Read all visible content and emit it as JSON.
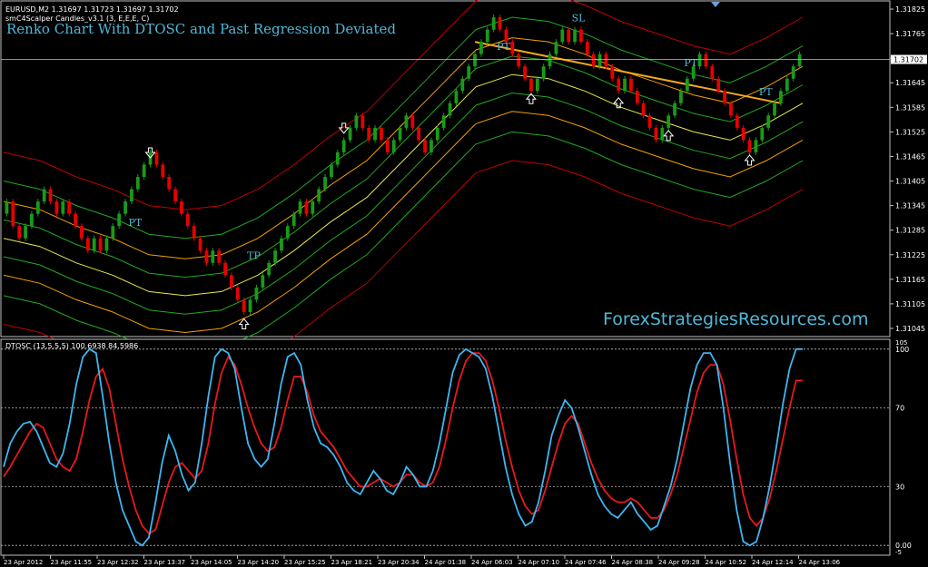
{
  "main_panel": {
    "symbol_header": "EURUSD,M2  1.31697 1.31723 1.31697 1.31702",
    "indicator_header": "smC4Scalper Candles_v3.1 (3, E,E,E, C)",
    "title": "Renko Chart With DTOSC and Past Regression Deviated",
    "watermark": "ForexStrategiesResources.com",
    "price_ticks": [
      "1.31765",
      "1.31705",
      "1.31645",
      "1.31585",
      "1.31525",
      "1.31465",
      "1.31405",
      "1.31345",
      "1.31285",
      "1.31225",
      "1.31165",
      "1.31105",
      "1.31045"
    ],
    "price_tick_values": [
      1.31765,
      1.31705,
      1.31645,
      1.31585,
      1.31525,
      1.31465,
      1.31405,
      1.31345,
      1.31285,
      1.31225,
      1.31165,
      1.31105,
      1.31045
    ],
    "current_price": "1.31702",
    "current_price_value": 1.31702,
    "top_tick": "1.31825",
    "top_tick_value": 1.31825,
    "annotations": [
      {
        "text": "PT",
        "pos": 20,
        "price": 1.31295
      },
      {
        "text": "TP",
        "pos": 39,
        "price": 1.31215
      },
      {
        "text": "PT",
        "pos": 79,
        "price": 1.31725
      },
      {
        "text": "SL",
        "pos": 91,
        "price": 1.31795
      },
      {
        "text": "PT",
        "pos": 109,
        "price": 1.31685
      },
      {
        "text": "PT",
        "pos": 121,
        "price": 1.31615
      }
    ],
    "arrows": [
      {
        "dir": "down",
        "pos": 23,
        "price": 1.31475
      },
      {
        "dir": "up",
        "pos": 38,
        "price": 1.31055
      },
      {
        "dir": "down",
        "pos": 54,
        "price": 1.31535
      },
      {
        "dir": "up",
        "pos": 84,
        "price": 1.31605
      },
      {
        "dir": "up",
        "pos": 98,
        "price": 1.31595
      },
      {
        "dir": "up",
        "pos": 106,
        "price": 1.31515
      },
      {
        "dir": "up",
        "pos": 119,
        "price": 1.31455
      }
    ],
    "top_marker_color": "#6ea0d8"
  },
  "sub_panel": {
    "header": "DTOSC (13,5,5,5) 100.6938 84.5986",
    "levels": [
      "100",
      "70",
      "30",
      "0.00"
    ],
    "level_values": [
      100,
      70,
      30,
      0
    ],
    "top_label": "105",
    "bottom_label": "-5",
    "fast_line_color": "#3fb6f0",
    "slow_line_color": "#e8191c"
  },
  "time_axis": {
    "labels": [
      "23 Apr 2012",
      "23 Apr 11:55",
      "23 Apr 12:32",
      "23 Apr 13:37",
      "23 Apr 14:05",
      "23 Apr 14:20",
      "23 Apr 15:25",
      "23 Apr 18:21",
      "23 Apr 20:34",
      "24 Apr 01:38",
      "24 Apr 06:03",
      "24 Apr 07:10",
      "24 Apr 07:46",
      "24 Apr 08:38",
      "24 Apr 09:28",
      "24 Apr 10:52",
      "24 Apr 12:14",
      "24 Apr 13:06"
    ]
  },
  "colors": {
    "bull_brick": "#1a9a1a",
    "bear_brick": "#e80000",
    "regression_line": "#f2a81d",
    "outer_band": "#c00000",
    "middle_band": "#f0a000",
    "inner_band": "#22a822",
    "center_band": "#e8e84a",
    "frame": "#c0c0c0",
    "title_text": "#4fb8d8",
    "text": "#ffffff"
  },
  "chart_data": [
    {
      "type": "renko",
      "title": "Renko Chart With DTOSC and Past Regression Deviated",
      "brick_size": 0.0003,
      "bricks_close": [
        1.31355,
        1.31295,
        1.31265,
        1.31295,
        1.31325,
        1.31355,
        1.31385,
        1.31355,
        1.31325,
        1.31355,
        1.31325,
        1.31295,
        1.31265,
        1.31235,
        1.31265,
        1.31235,
        1.31265,
        1.31295,
        1.31325,
        1.31355,
        1.31385,
        1.31415,
        1.31445,
        1.31475,
        1.31445,
        1.31415,
        1.31385,
        1.31355,
        1.31325,
        1.31295,
        1.31265,
        1.31235,
        1.31205,
        1.31235,
        1.31205,
        1.31175,
        1.31145,
        1.31115,
        1.31085,
        1.31115,
        1.31145,
        1.31175,
        1.31205,
        1.31235,
        1.31265,
        1.31295,
        1.31325,
        1.31355,
        1.31325,
        1.31355,
        1.31385,
        1.31415,
        1.31445,
        1.31475,
        1.31505,
        1.31535,
        1.31565,
        1.31535,
        1.31505,
        1.31535,
        1.31505,
        1.31475,
        1.31505,
        1.31535,
        1.31565,
        1.31535,
        1.31505,
        1.31475,
        1.31505,
        1.31535,
        1.31565,
        1.31595,
        1.31625,
        1.31655,
        1.31685,
        1.31715,
        1.31745,
        1.31775,
        1.31805,
        1.31775,
        1.31745,
        1.31715,
        1.31685,
        1.31655,
        1.31625,
        1.31655,
        1.31685,
        1.31715,
        1.31745,
        1.31775,
        1.31745,
        1.31775,
        1.31745,
        1.31715,
        1.31685,
        1.31715,
        1.31685,
        1.31655,
        1.31625,
        1.31655,
        1.31625,
        1.31595,
        1.31565,
        1.31535,
        1.31505,
        1.31535,
        1.31565,
        1.31595,
        1.31625,
        1.31655,
        1.31685,
        1.31715,
        1.31685,
        1.31655,
        1.31625,
        1.31595,
        1.31565,
        1.31535,
        1.31505,
        1.31475,
        1.31505,
        1.31535,
        1.31565,
        1.31595,
        1.31625,
        1.31655,
        1.31685,
        1.31715
      ],
      "regression": {
        "from_pos": 75,
        "to_pos": 124,
        "from_price": 1.31745,
        "to_price": 1.31595
      },
      "center_band": [
        1.31265,
        1.31245,
        1.31205,
        1.31175,
        1.31135,
        1.31125,
        1.31135,
        1.31175,
        1.31235,
        1.31305,
        1.31365,
        1.31455,
        1.31545,
        1.31635,
        1.31665,
        1.31655,
        1.31625,
        1.31585,
        1.31555,
        1.31525,
        1.31505,
        1.31545,
        1.31595
      ],
      "band_offsets": [
        0.00045,
        0.0009,
        0.0014,
        0.0021
      ],
      "ylim": [
        1.31025,
        1.31845
      ]
    },
    {
      "type": "line",
      "title": "DTOSC (13,5,5,5)",
      "ylim": [
        -5,
        105
      ],
      "series": [
        {
          "name": "100.6938",
          "values": [
            40,
            52,
            58,
            62,
            63,
            58,
            50,
            42,
            40,
            47,
            62,
            82,
            96,
            100,
            98,
            76,
            52,
            32,
            18,
            10,
            2,
            0,
            4,
            22,
            42,
            56,
            48,
            36,
            28,
            32,
            52,
            76,
            96,
            100,
            98,
            90,
            70,
            52,
            44,
            40,
            44,
            62,
            82,
            96,
            98,
            92,
            74,
            60,
            52,
            50,
            46,
            40,
            32,
            28,
            26,
            32,
            38,
            34,
            28,
            26,
            32,
            40,
            36,
            30,
            30,
            38,
            52,
            70,
            88,
            97,
            100,
            98,
            96,
            90,
            76,
            58,
            40,
            26,
            16,
            10,
            12,
            22,
            38,
            56,
            66,
            74,
            70,
            60,
            48,
            36,
            26,
            20,
            16,
            14,
            18,
            22,
            16,
            12,
            8,
            10,
            20,
            30,
            44,
            62,
            80,
            92,
            98,
            98,
            92,
            70,
            42,
            18,
            2,
            0,
            2,
            14,
            30,
            50,
            72,
            90,
            100,
            100
          ]
        },
        {
          "name": "84.5986",
          "values": [
            35,
            40,
            46,
            52,
            58,
            62,
            60,
            52,
            44,
            40,
            38,
            44,
            58,
            74,
            86,
            90,
            80,
            62,
            44,
            30,
            18,
            10,
            6,
            8,
            20,
            32,
            40,
            42,
            38,
            34,
            38,
            52,
            72,
            88,
            96,
            92,
            82,
            70,
            60,
            52,
            48,
            50,
            60,
            74,
            86,
            86,
            78,
            66,
            58,
            54,
            50,
            44,
            38,
            34,
            30,
            30,
            32,
            34,
            32,
            30,
            32,
            36,
            36,
            32,
            30,
            32,
            40,
            54,
            70,
            84,
            94,
            98,
            98,
            94,
            84,
            70,
            54,
            40,
            28,
            20,
            16,
            18,
            28,
            40,
            52,
            62,
            66,
            62,
            52,
            42,
            34,
            28,
            24,
            22,
            22,
            24,
            22,
            18,
            14,
            14,
            18,
            26,
            36,
            50,
            64,
            78,
            88,
            92,
            92,
            82,
            64,
            44,
            26,
            14,
            10,
            14,
            24,
            38,
            54,
            70,
            84,
            84
          ]
        }
      ]
    }
  ]
}
